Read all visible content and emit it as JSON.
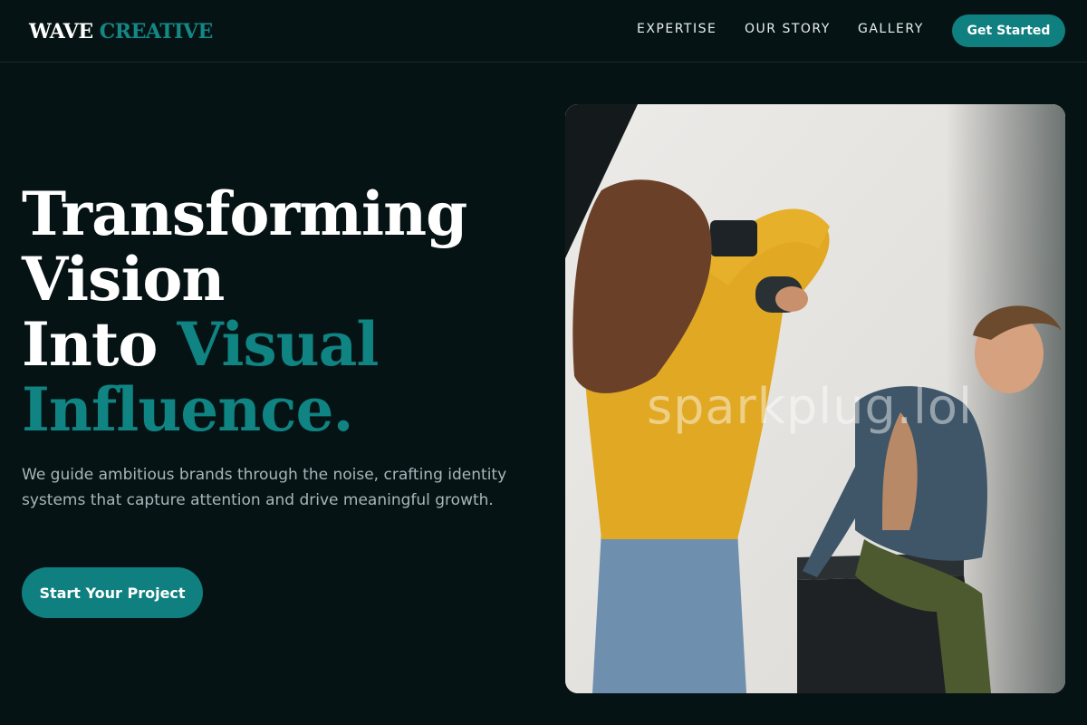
{
  "header": {
    "logo_primary": "WAVE",
    "logo_accent": "CREATIVE",
    "nav": [
      "EXPERTISE",
      "OUR STORY",
      "GALLERY"
    ],
    "cta_label": "Get Started"
  },
  "hero": {
    "title_lines": [
      "Transforming",
      "Vision",
      "Into",
      "Visual",
      "Influence."
    ],
    "subtitle": "We guide ambitious brands through the noise, crafting identity systems that capture attention and drive meaningful growth.",
    "cta_label": "Start Your Project"
  },
  "image": {
    "watermark": "sparkplug.lol"
  },
  "colors": {
    "background": "#061314",
    "accent": "#0f7f80",
    "accent_text": "#0f8482",
    "muted_text": "#a6b6ba"
  }
}
